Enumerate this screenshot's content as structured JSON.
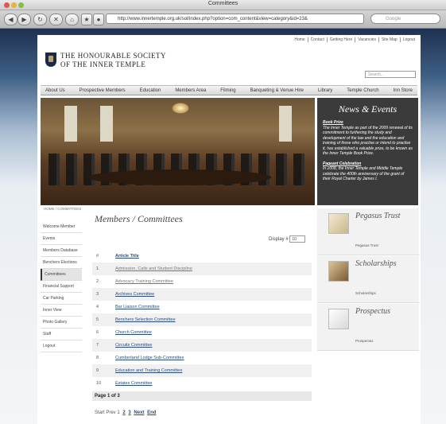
{
  "window": {
    "title": "Committees",
    "url": "http://www.innertemple.org.uk/sol/index.php?option=com_content&view=category&id=23&",
    "search_placeholder": "Google"
  },
  "site": {
    "name_line1": "THE HONOURABLE SOCIETY",
    "name_line2": "OF THE INNER TEMPLE",
    "search_placeholder": "Search...",
    "top_links": [
      "Home",
      "Contact",
      "Getting Here",
      "Vacancies",
      "Site Map",
      "Logout"
    ],
    "nav": [
      "About Us",
      "Prospective Members",
      "Education",
      "Members Area",
      "Filming",
      "Banqueting & Venue Hire",
      "Library",
      "Temple Church",
      "Inn Store"
    ]
  },
  "news": {
    "title": "News & Events",
    "items": [
      {
        "heading": "Book Prize",
        "text": "The Inner Temple as part of the 2009 renewal of its commitment to furthering the study and development of the law and the education and training of those who practise or intend to practise it, has established a valuable prize, to be known as the Inner Temple Book Prize."
      },
      {
        "heading": "Pageant Celebration",
        "text": "In 2008, the Inner Temple and Middle Temple celebrate the 400th anniversary of the grant of their Royal Charter by James I."
      }
    ]
  },
  "breadcrumb": "HOME / COMMITTEES",
  "sidebar": [
    "Welcome Member",
    "Events",
    "Members Database",
    "Benchers Elections",
    "Committees",
    "Financial Support",
    "Car Parking",
    "Inner View",
    "Photo Gallery",
    "Staff",
    "Logout"
  ],
  "sidebar_active_index": 4,
  "heading": "Members / Committees",
  "display": {
    "label": "Display #",
    "value": "10"
  },
  "table": {
    "col_num": "#",
    "col_title": "Article Title",
    "rows": [
      {
        "n": "1",
        "title": "Admission, Calls and Student Discipline"
      },
      {
        "n": "2",
        "title": "Advocacy Training Committee"
      },
      {
        "n": "3",
        "title": "Archives Committee"
      },
      {
        "n": "4",
        "title": "Bar Liaison Committee"
      },
      {
        "n": "5",
        "title": "Benchers Selection Committee"
      },
      {
        "n": "6",
        "title": "Church Committee"
      },
      {
        "n": "7",
        "title": "Circuits Committee"
      },
      {
        "n": "8",
        "title": "Cumberland Lodge Sub-Committee"
      },
      {
        "n": "9",
        "title": "Education and Training Committee"
      },
      {
        "n": "10",
        "title": "Estates Committee"
      }
    ]
  },
  "page_of": "Page 1 of 3",
  "pager": {
    "start": "Start",
    "prev": "Prev",
    "current": "1",
    "p2": "2",
    "p3": "3",
    "next": "Next",
    "end": "End"
  },
  "promos": [
    {
      "title": "Pegasus Trust",
      "caption": "Pegasus Trust"
    },
    {
      "title": "Scholarships",
      "caption": "Scholarships"
    },
    {
      "title": "Prospectus",
      "caption": "Prospectus"
    }
  ]
}
